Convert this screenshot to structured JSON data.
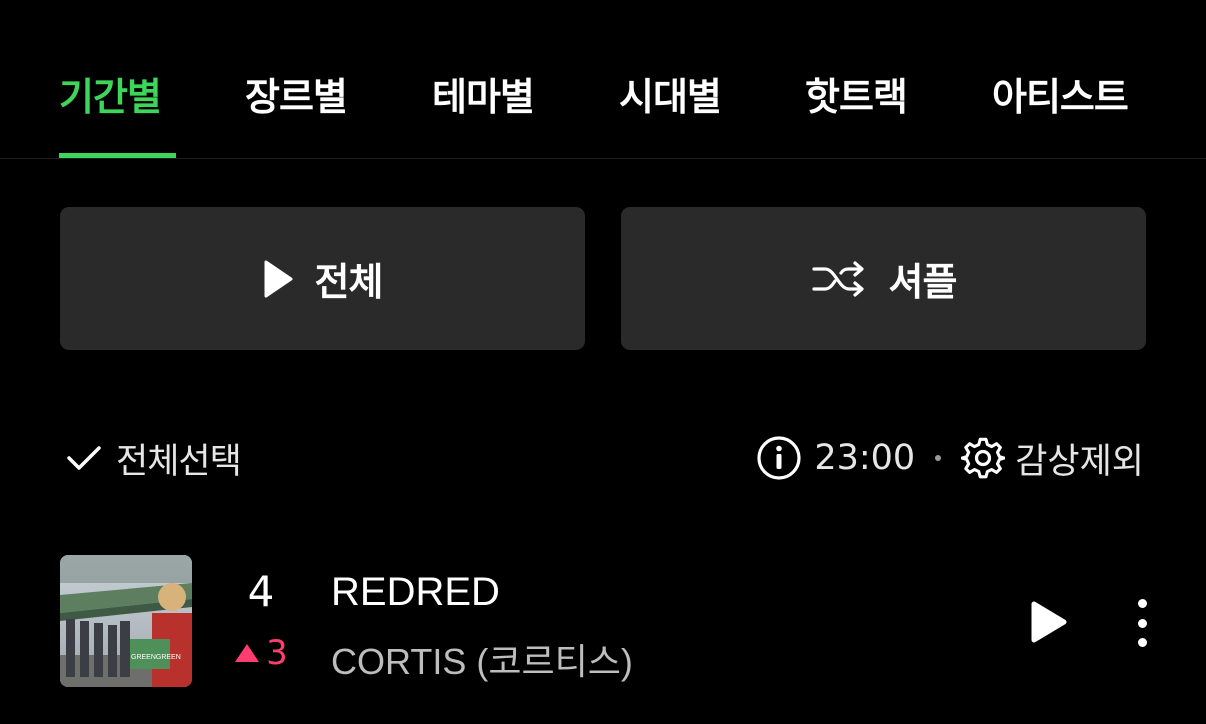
{
  "tabs": [
    {
      "label": "기간별",
      "active": true
    },
    {
      "label": "장르별",
      "active": false
    },
    {
      "label": "테마별",
      "active": false
    },
    {
      "label": "시대별",
      "active": false
    },
    {
      "label": "핫트랙",
      "active": false
    },
    {
      "label": "아티스트",
      "active": false
    }
  ],
  "actions": {
    "play_all_label": "전체",
    "shuffle_label": "셔플"
  },
  "toolbar": {
    "select_all_label": "전체선택",
    "time": "23:00",
    "exclude_label": "감상제외"
  },
  "songs": [
    {
      "rank": "4",
      "change": "3",
      "change_direction": "up",
      "title": "REDRED",
      "artist": "CORTIS (코르티스)",
      "album_art_text": "GREENGREEN"
    }
  ],
  "colors": {
    "accent": "#3ed65a",
    "rank_up": "#ff3d6e",
    "button_bg": "#2a2a2a",
    "background": "#000000"
  }
}
